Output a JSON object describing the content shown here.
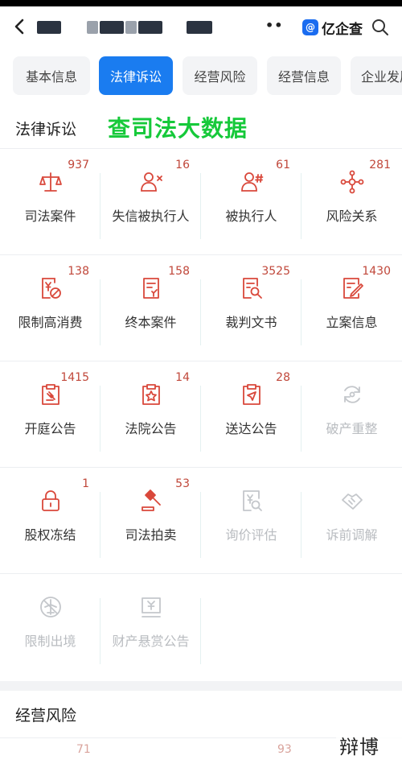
{
  "header": {
    "brand_badge": "@",
    "brand_name": "亿企查",
    "more_dots": "••"
  },
  "tabs": [
    {
      "label": "基本信息",
      "active": false
    },
    {
      "label": "法律诉讼",
      "active": true
    },
    {
      "label": "经营风险",
      "active": false
    },
    {
      "label": "经营信息",
      "active": false
    },
    {
      "label": "企业发展",
      "active": false
    }
  ],
  "legal_section": {
    "title": "法律诉讼",
    "promo": "查司法大数据"
  },
  "items": [
    {
      "label": "司法案件",
      "count": "937",
      "icon": "scales-icon",
      "enabled": true
    },
    {
      "label": "失信被执行人",
      "count": "16",
      "icon": "person-x-icon",
      "enabled": true
    },
    {
      "label": "被执行人",
      "count": "61",
      "icon": "person-hash-icon",
      "enabled": true
    },
    {
      "label": "风险关系",
      "count": "281",
      "icon": "network-icon",
      "enabled": true
    },
    {
      "label": "限制高消费",
      "count": "138",
      "icon": "yen-ban-icon",
      "enabled": true
    },
    {
      "label": "终本案件",
      "count": "158",
      "icon": "document-end-icon",
      "enabled": true
    },
    {
      "label": "裁判文书",
      "count": "3525",
      "icon": "document-search-icon",
      "enabled": true
    },
    {
      "label": "立案信息",
      "count": "1430",
      "icon": "document-edit-icon",
      "enabled": true
    },
    {
      "label": "开庭公告",
      "count": "1415",
      "icon": "clipboard-gavel-icon",
      "enabled": true
    },
    {
      "label": "法院公告",
      "count": "14",
      "icon": "clipboard-star-icon",
      "enabled": true
    },
    {
      "label": "送达公告",
      "count": "28",
      "icon": "clipboard-send-icon",
      "enabled": true
    },
    {
      "label": "破产重整",
      "count": "",
      "icon": "refresh-icon",
      "enabled": false
    },
    {
      "label": "股权冻结",
      "count": "1",
      "icon": "lock-icon",
      "enabled": true
    },
    {
      "label": "司法拍卖",
      "count": "53",
      "icon": "gavel-icon",
      "enabled": true
    },
    {
      "label": "询价评估",
      "count": "",
      "icon": "yen-search-icon",
      "enabled": false
    },
    {
      "label": "诉前调解",
      "count": "",
      "icon": "handshake-icon",
      "enabled": false
    },
    {
      "label": "限制出境",
      "count": "",
      "icon": "plane-ban-icon",
      "enabled": false
    },
    {
      "label": "财产悬赏公告",
      "count": "",
      "icon": "yen-board-icon",
      "enabled": false
    }
  ],
  "risk_section": {
    "title": "经营风险",
    "counts": [
      "71",
      "93"
    ]
  },
  "watermark": "辩博网",
  "colors": {
    "accent": "#1a7cf0",
    "icon_red": "#d9483b",
    "promo_green": "#16c93a",
    "disabled": "#b9bcc0"
  }
}
